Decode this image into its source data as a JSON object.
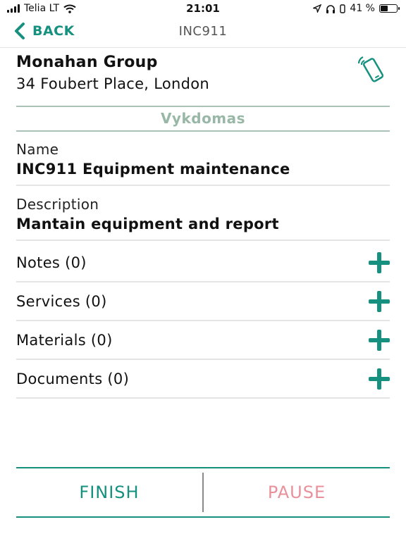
{
  "status_bar": {
    "carrier": "Telia LT",
    "time": "21:01",
    "battery": "41 %",
    "battery_level": 0.41
  },
  "nav": {
    "back_label": "BACK",
    "title": "INC911"
  },
  "customer": {
    "name": "Monahan Group",
    "address": "34 Foubert Place, London"
  },
  "status_label": "Vykdomas",
  "fields": {
    "name_label": "Name",
    "name_value": "INC911 Equipment maintenance",
    "description_label": "Description",
    "description_value": "Mantain equipment and report"
  },
  "sections": [
    {
      "label": "Notes (0)"
    },
    {
      "label": "Services (0)"
    },
    {
      "label": "Materials (0)"
    },
    {
      "label": "Documents (0)"
    }
  ],
  "actions": {
    "finish_label": "FINISH",
    "pause_label": "PAUSE"
  },
  "colors": {
    "accent": "#16907f",
    "status": "#98b7a6",
    "pause": "#e8919b"
  }
}
